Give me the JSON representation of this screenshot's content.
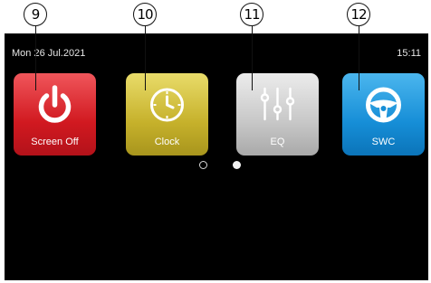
{
  "callouts": [
    "9",
    "10",
    "11",
    "12"
  ],
  "status": {
    "date": "Mon 26 Jul.2021",
    "time": "15:11"
  },
  "apps": [
    {
      "label": "Screen Off",
      "icon": "power-icon"
    },
    {
      "label": "Clock",
      "icon": "clock-icon"
    },
    {
      "label": "EQ",
      "icon": "equalizer-icon"
    },
    {
      "label": "SWC",
      "icon": "steering-wheel-icon"
    }
  ],
  "pager": {
    "pages": 2,
    "current": 2
  }
}
